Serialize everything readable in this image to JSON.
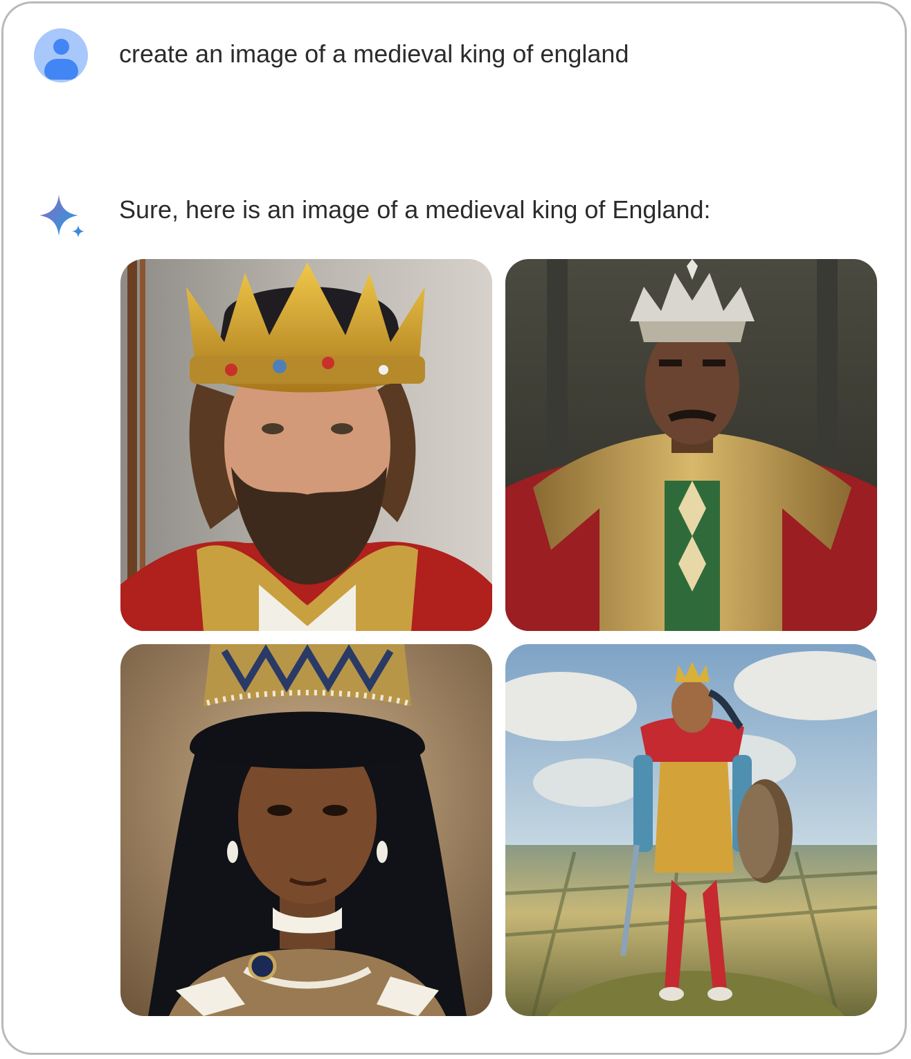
{
  "user_prompt": {
    "avatar_icon": "person-avatar-icon",
    "text": "create an image of a medieval king of england"
  },
  "assistant_reply": {
    "icon": "gemini-sparkle-icon",
    "text": "Sure, here is an image of a medieval king of England:"
  },
  "images": [
    {
      "id": 1
    },
    {
      "id": 2
    },
    {
      "id": 3
    },
    {
      "id": 4
    }
  ],
  "colors": {
    "avatar_bg": "#a8c7fa",
    "avatar_fg": "#4285f4",
    "text": "#2b2b2b",
    "border": "#b9b9b9"
  }
}
